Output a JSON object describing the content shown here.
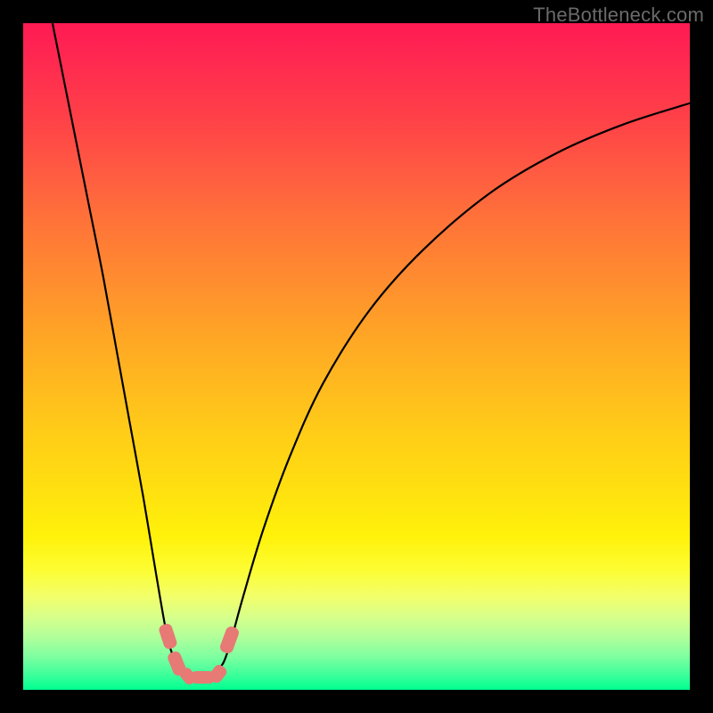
{
  "watermark": "TheBottleneck.com",
  "colors": {
    "frame_bg": "#000000",
    "curve_stroke": "#000000",
    "marker_fill": "#e77a74",
    "gradient_top": "#ff1a53",
    "gradient_bottom": "#00ff90"
  },
  "chart_data": {
    "type": "line",
    "title": "",
    "xlabel": "",
    "ylabel": "",
    "xlim": [
      0,
      100
    ],
    "ylim": [
      0,
      100
    ],
    "note": "Values estimated from pixel positions; y=100 is top of plot, y=0 is bottom",
    "series": [
      {
        "name": "curve-left",
        "x": [
          4.4,
          6.0,
          8.0,
          10.0,
          12.0,
          14.0,
          16.0,
          18.0,
          20.0,
          21.5,
          22.5,
          23.5,
          24.5
        ],
        "y": [
          100,
          92,
          82,
          72,
          62,
          51,
          40,
          29,
          17,
          8.5,
          5.0,
          3.0,
          2.4
        ]
      },
      {
        "name": "curve-floor",
        "x": [
          24.5,
          25.5,
          27.0,
          28.5
        ],
        "y": [
          2.4,
          2.2,
          2.2,
          2.5
        ]
      },
      {
        "name": "curve-right",
        "x": [
          28.5,
          30.0,
          31.2,
          33.0,
          36.0,
          40.0,
          45.0,
          52.0,
          60.0,
          70.0,
          80.0,
          90.0,
          100.0
        ],
        "y": [
          2.5,
          4.0,
          7.5,
          14.0,
          24.0,
          35.0,
          46.0,
          57.0,
          66.0,
          74.5,
          80.5,
          84.8,
          88.0
        ]
      }
    ],
    "markers": [
      {
        "name": "left-upper",
        "cx": 21.7,
        "cy": 8.0,
        "w": 2.0,
        "h": 3.8,
        "rot": -18
      },
      {
        "name": "left-mid",
        "cx": 23.1,
        "cy": 4.0,
        "w": 2.0,
        "h": 3.6,
        "rot": -22
      },
      {
        "name": "left-low",
        "cx": 24.7,
        "cy": 2.0,
        "w": 1.9,
        "h": 2.6,
        "rot": -40
      },
      {
        "name": "floor",
        "cx": 27.0,
        "cy": 1.9,
        "w": 3.6,
        "h": 1.8,
        "rot": 0
      },
      {
        "name": "right-low",
        "cx": 29.2,
        "cy": 2.4,
        "w": 2.0,
        "h": 2.7,
        "rot": 38
      },
      {
        "name": "right-upper",
        "cx": 31.0,
        "cy": 7.5,
        "w": 2.0,
        "h": 4.0,
        "rot": 20
      }
    ]
  }
}
